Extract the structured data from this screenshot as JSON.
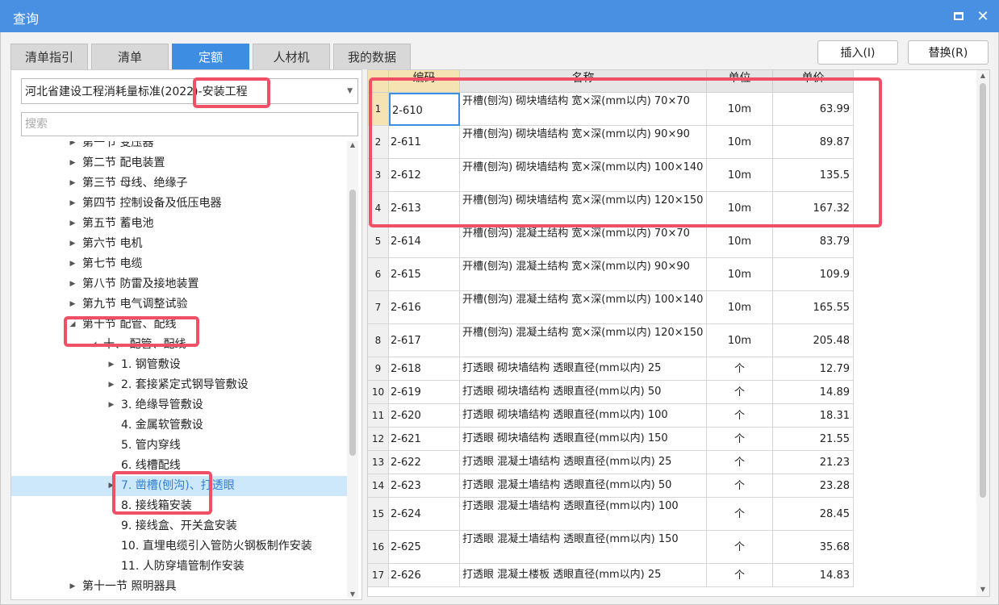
{
  "window": {
    "title": "查询"
  },
  "tabs": [
    {
      "label": "清单指引",
      "active": false
    },
    {
      "label": "清单",
      "active": false
    },
    {
      "label": "定额",
      "active": true
    },
    {
      "label": "人材机",
      "active": false
    },
    {
      "label": "我的数据",
      "active": false
    }
  ],
  "actions": {
    "insert_label": "插入(I)",
    "replace_label": "替换(R)"
  },
  "left": {
    "standard_select": "河北省建设工程消耗量标准(2022)-安装工程",
    "search_placeholder": "搜索",
    "tree": [
      {
        "label": "第一节 变压器",
        "level": 0,
        "expand": "right"
      },
      {
        "label": "第二节 配电装置",
        "level": 0,
        "expand": "right"
      },
      {
        "label": "第三节 母线、绝缘子",
        "level": 0,
        "expand": "right"
      },
      {
        "label": "第四节 控制设备及低压电器",
        "level": 0,
        "expand": "right"
      },
      {
        "label": "第五节 蓄电池",
        "level": 0,
        "expand": "right"
      },
      {
        "label": "第六节 电机",
        "level": 0,
        "expand": "right"
      },
      {
        "label": "第七节 电缆",
        "level": 0,
        "expand": "right"
      },
      {
        "label": "第八节 防雷及接地装置",
        "level": 0,
        "expand": "right"
      },
      {
        "label": "第九节 电气调整试验",
        "level": 0,
        "expand": "right"
      },
      {
        "label": "第十节 配管、配线",
        "level": 0,
        "expand": "down"
      },
      {
        "label": "十、 配管、配线",
        "level": 1,
        "expand": "down"
      },
      {
        "label": "1. 钢管敷设",
        "level": 2,
        "expand": "right"
      },
      {
        "label": "2. 套接紧定式钢导管敷设",
        "level": 2,
        "expand": "right"
      },
      {
        "label": "3. 绝缘导管敷设",
        "level": 2,
        "expand": "right"
      },
      {
        "label": "4. 金属软管敷设",
        "level": 2,
        "expand": "none"
      },
      {
        "label": "5. 管内穿线",
        "level": 2,
        "expand": "none"
      },
      {
        "label": "6. 线槽配线",
        "level": 2,
        "expand": "none"
      },
      {
        "label": "7. 凿槽(刨沟)、打透眼",
        "level": 2,
        "expand": "right",
        "selected": true
      },
      {
        "label": "8. 接线箱安装",
        "level": 2,
        "expand": "none"
      },
      {
        "label": "9. 接线盒、开关盒安装",
        "level": 2,
        "expand": "none"
      },
      {
        "label": "10. 直埋电缆引入管防火钢板制作安装",
        "level": 2,
        "expand": "none"
      },
      {
        "label": "11. 人防穿墙管制作安装",
        "level": 2,
        "expand": "none"
      },
      {
        "label": "第十一节 照明器具",
        "level": 0,
        "expand": "right"
      }
    ]
  },
  "grid": {
    "headers": {
      "code": "编码",
      "name": "名称",
      "unit": "单位",
      "price": "单价"
    },
    "rows": [
      {
        "idx": "1",
        "code": "2-610",
        "name": "开槽(刨沟) 砌块墙结构 宽×深(mm以内) 70×70",
        "unit": "10m",
        "price": "63.99"
      },
      {
        "idx": "2",
        "code": "2-611",
        "name": "开槽(刨沟) 砌块墙结构 宽×深(mm以内) 90×90",
        "unit": "10m",
        "price": "89.87"
      },
      {
        "idx": "3",
        "code": "2-612",
        "name": "开槽(刨沟) 砌块墙结构 宽×深(mm以内) 100×140",
        "unit": "10m",
        "price": "135.5"
      },
      {
        "idx": "4",
        "code": "2-613",
        "name": "开槽(刨沟) 砌块墙结构 宽×深(mm以内) 120×150",
        "unit": "10m",
        "price": "167.32"
      },
      {
        "idx": "5",
        "code": "2-614",
        "name": "开槽(刨沟) 混凝土结构 宽×深(mm以内) 70×70",
        "unit": "10m",
        "price": "83.79"
      },
      {
        "idx": "6",
        "code": "2-615",
        "name": "开槽(刨沟) 混凝土结构 宽×深(mm以内) 90×90",
        "unit": "10m",
        "price": "109.9"
      },
      {
        "idx": "7",
        "code": "2-616",
        "name": "开槽(刨沟) 混凝土结构 宽×深(mm以内) 100×140",
        "unit": "10m",
        "price": "165.55"
      },
      {
        "idx": "8",
        "code": "2-617",
        "name": "开槽(刨沟) 混凝土结构 宽×深(mm以内) 120×150",
        "unit": "10m",
        "price": "205.48"
      },
      {
        "idx": "9",
        "code": "2-618",
        "name": "打透眼 砌块墙结构 透眼直径(mm以内) 25",
        "unit": "个",
        "price": "12.79"
      },
      {
        "idx": "10",
        "code": "2-619",
        "name": "打透眼 砌块墙结构 透眼直径(mm以内) 50",
        "unit": "个",
        "price": "14.89"
      },
      {
        "idx": "11",
        "code": "2-620",
        "name": "打透眼 砌块墙结构 透眼直径(mm以内) 100",
        "unit": "个",
        "price": "18.31"
      },
      {
        "idx": "12",
        "code": "2-621",
        "name": "打透眼 砌块墙结构 透眼直径(mm以内) 150",
        "unit": "个",
        "price": "21.55"
      },
      {
        "idx": "13",
        "code": "2-622",
        "name": "打透眼 混凝土墙结构 透眼直径(mm以内) 25",
        "unit": "个",
        "price": "21.23"
      },
      {
        "idx": "14",
        "code": "2-623",
        "name": "打透眼 混凝土墙结构 透眼直径(mm以内) 50",
        "unit": "个",
        "price": "23.28"
      },
      {
        "idx": "15",
        "code": "2-624",
        "name": "打透眼 混凝土墙结构 透眼直径(mm以内) 100",
        "unit": "个",
        "price": "28.45"
      },
      {
        "idx": "16",
        "code": "2-625",
        "name": "打透眼 混凝土墙结构 透眼直径(mm以内) 150",
        "unit": "个",
        "price": "35.68"
      },
      {
        "idx": "17",
        "code": "2-626",
        "name": "打透眼 混凝土楼板 透眼直径(mm以内) 25",
        "unit": "个",
        "price": "14.83"
      }
    ]
  },
  "colors": {
    "accent": "#3d8de3",
    "titlebar": "#4a90e2",
    "highlight": "#f05065",
    "header_selected": "#f5e3b3",
    "tree_selected": "#cde7fb"
  }
}
